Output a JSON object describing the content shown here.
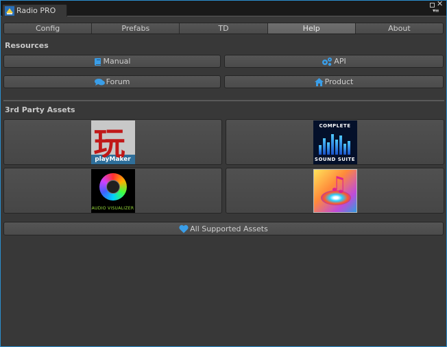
{
  "window": {
    "tab_title": "Radio PRO",
    "close_glyph": "✕",
    "menu_glyph": "▾≡"
  },
  "toolbar": {
    "items": [
      {
        "label": "Config",
        "active": false
      },
      {
        "label": "Prefabs",
        "active": false
      },
      {
        "label": "TD",
        "active": false
      },
      {
        "label": "Help",
        "active": true
      },
      {
        "label": "About",
        "active": false
      }
    ]
  },
  "resources": {
    "title": "Resources",
    "manual": "Manual",
    "api": "API",
    "forum": "Forum",
    "product": "Product"
  },
  "third_party": {
    "title": "3rd Party Assets",
    "assets": [
      {
        "icon": "playmaker-logo",
        "glyph": "玩",
        "label": "playMaker"
      },
      {
        "icon": "complete-sound-suite-logo",
        "title": "COMPLETE",
        "subtitle": "SOUND SUITE"
      },
      {
        "icon": "audio-visualizer-logo",
        "label": "AUDIO VISUALIZER"
      },
      {
        "icon": "music-note-logo",
        "glyph": "♫"
      }
    ],
    "all_supported": "All Supported Assets"
  },
  "colors": {
    "accent_blue": "#3a9ee8",
    "heart": "#3a9ee8",
    "background": "#383838"
  }
}
